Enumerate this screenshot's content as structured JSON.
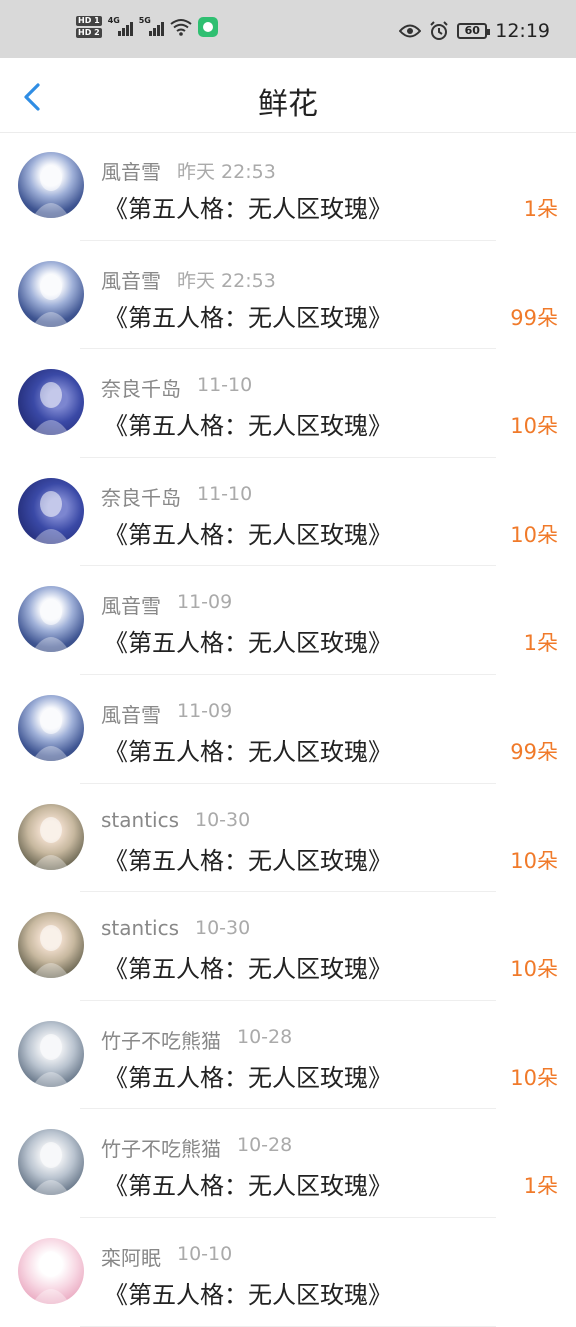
{
  "status_bar": {
    "hd1": "HD 1",
    "hd2": "HD 2",
    "net1": "4G",
    "net2": "5G",
    "battery": "60",
    "time": "12:19"
  },
  "header": {
    "title": "鲜花"
  },
  "records": [
    {
      "name": "風音雪",
      "time": "昨天 22:53",
      "gift": "《第五人格：无人区玫瑰》",
      "count": "1朵",
      "avatar": "av-blue-light"
    },
    {
      "name": "風音雪",
      "time": "昨天 22:53",
      "gift": "《第五人格：无人区玫瑰》",
      "count": "99朵",
      "avatar": "av-blue-light"
    },
    {
      "name": "奈良千岛",
      "time": "11-10",
      "gift": "《第五人格：无人区玫瑰》",
      "count": "10朵",
      "avatar": "av-indigo"
    },
    {
      "name": "奈良千岛",
      "time": "11-10",
      "gift": "《第五人格：无人区玫瑰》",
      "count": "10朵",
      "avatar": "av-indigo"
    },
    {
      "name": "風音雪",
      "time": "11-09",
      "gift": "《第五人格：无人区玫瑰》",
      "count": "1朵",
      "avatar": "av-blue-light"
    },
    {
      "name": "風音雪",
      "time": "11-09",
      "gift": "《第五人格：无人区玫瑰》",
      "count": "99朵",
      "avatar": "av-blue-light"
    },
    {
      "name": "stantics",
      "time": "10-30",
      "gift": "《第五人格：无人区玫瑰》",
      "count": "10朵",
      "avatar": "av-tan"
    },
    {
      "name": "stantics",
      "time": "10-30",
      "gift": "《第五人格：无人区玫瑰》",
      "count": "10朵",
      "avatar": "av-tan"
    },
    {
      "name": "竹子不吃熊猫",
      "time": "10-28",
      "gift": "《第五人格：无人区玫瑰》",
      "count": "10朵",
      "avatar": "av-grey"
    },
    {
      "name": "竹子不吃熊猫",
      "time": "10-28",
      "gift": "《第五人格：无人区玫瑰》",
      "count": "1朵",
      "avatar": "av-grey"
    },
    {
      "name": "栾阿眠",
      "time": "10-10",
      "gift": "《第五人格：无人区玫瑰》",
      "count": "",
      "avatar": "av-pink"
    }
  ]
}
